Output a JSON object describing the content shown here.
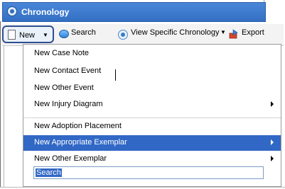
{
  "window": {
    "title": "Chronology"
  },
  "toolbar": {
    "new_label": "New",
    "search_label": "Search",
    "view_label": "View Specific Chronology",
    "export_label": "Export"
  },
  "menu": {
    "items": [
      {
        "label": "New Case Note"
      },
      {
        "label": "New Contact Event"
      },
      {
        "label": "New Other Event"
      },
      {
        "label": "New Injury Diagram"
      },
      {
        "label": "New Adoption Placement"
      },
      {
        "label": "New Appropriate Exemplar"
      },
      {
        "label": "New Other Exemplar"
      }
    ],
    "search_value": "Search"
  },
  "colors": {
    "accent": "#3168c6",
    "title_bar": "#3f7bcf"
  }
}
